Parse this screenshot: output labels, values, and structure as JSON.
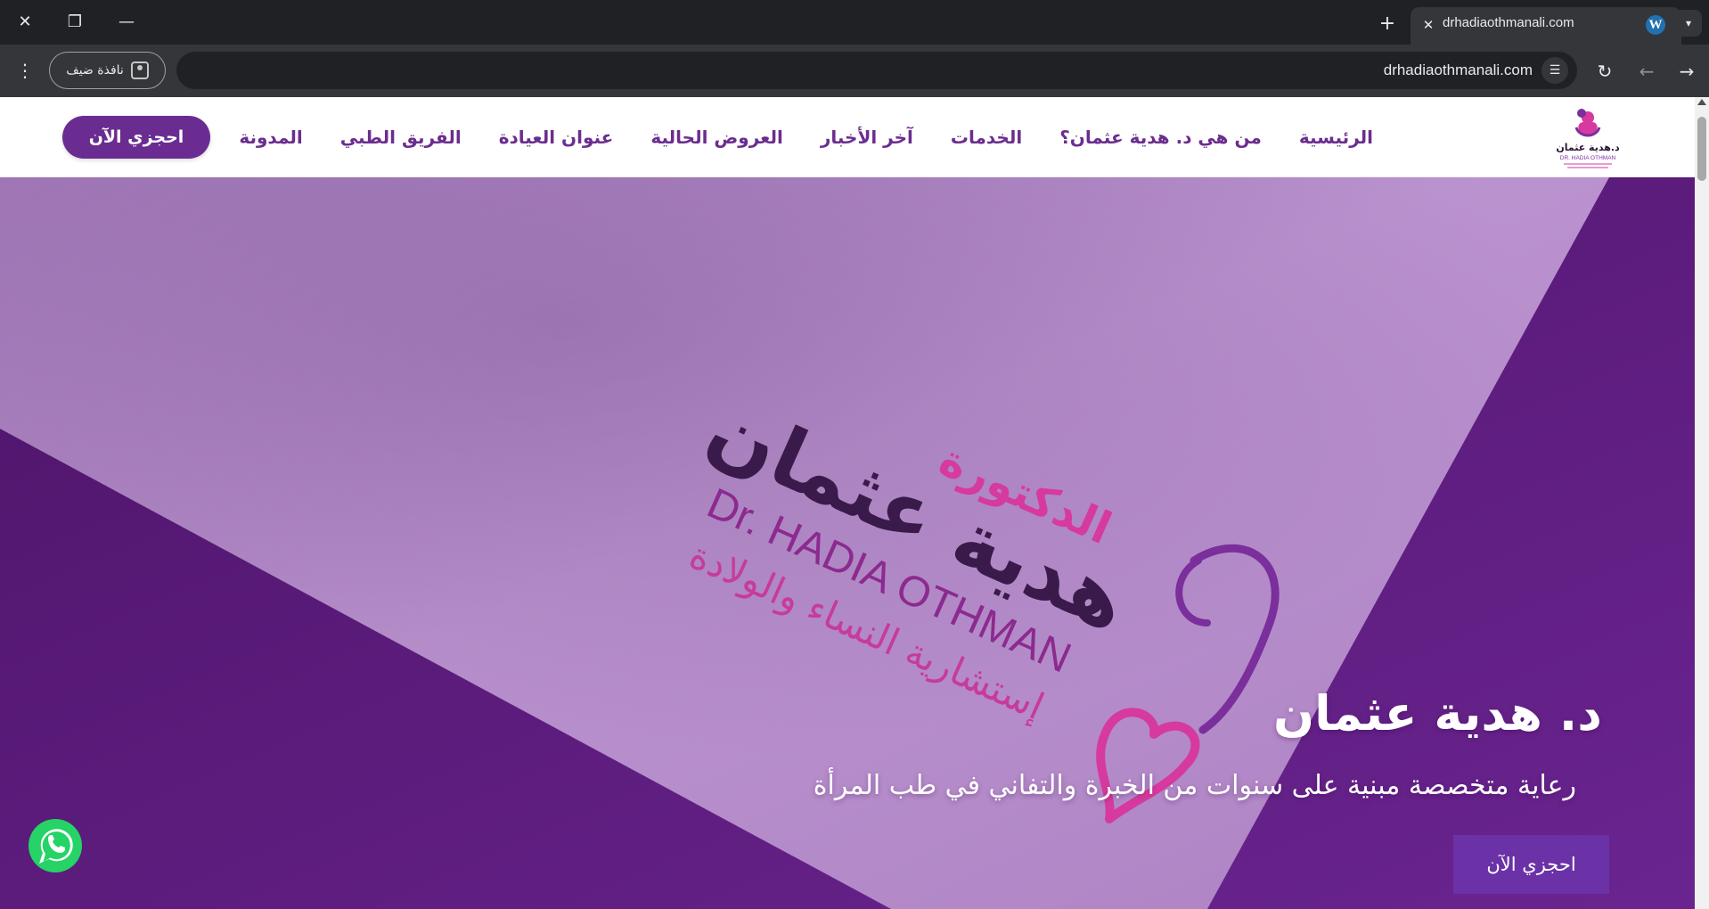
{
  "browser": {
    "tab": {
      "title": "drhadiaothmanali.com",
      "favicon": "wordpress-icon"
    },
    "address_bar": {
      "url": "drhadiaothmanali.com"
    },
    "profile_chip": {
      "label": "نافذة ضيف",
      "icon": "guest-profile-icon"
    },
    "window_controls": [
      "close-icon",
      "restore-icon",
      "minimize-icon"
    ],
    "toolbar_icons": [
      "menu-kebab-icon",
      "reload-icon",
      "back-icon",
      "forward-icon",
      "site-settings-icon"
    ]
  },
  "site": {
    "logo": {
      "name": "د.هدية عثمان",
      "latin": "DR. HADIA OTHMAN"
    },
    "nav": {
      "items": [
        {
          "label": "الرئيسية"
        },
        {
          "label": "من هي د. هدية عثمان؟"
        },
        {
          "label": "الخدمات"
        },
        {
          "label": "آخر الأخبار"
        },
        {
          "label": "العروض الحالية"
        },
        {
          "label": "عنوان العيادة"
        },
        {
          "label": "الفريق الطبي"
        },
        {
          "label": "المدونة"
        }
      ],
      "cta_label": "احجزي الآن"
    },
    "hero": {
      "title": "د. هدية عثمان",
      "subtitle": "رعاية متخصصة مبنية على سنوات من الخبرة والتفاني في طب المرأة",
      "button_label": "احجزي الآن",
      "paper_logo": {
        "line_top": "الدكتورة",
        "line_main": "هدية عثمان",
        "line_latin": "Dr. HADIA OTHMAN",
        "line_specialty": "إستشارية النساء والولادة"
      }
    },
    "floating": {
      "whatsapp_icon": "whatsapp-icon"
    }
  },
  "colors": {
    "brand_purple": "#6b2d8f",
    "brand_pink": "#d63a9e",
    "hero_background": "#5a1a78",
    "paper_lilac": "#b38bc7",
    "whatsapp_green": "#25d366"
  }
}
